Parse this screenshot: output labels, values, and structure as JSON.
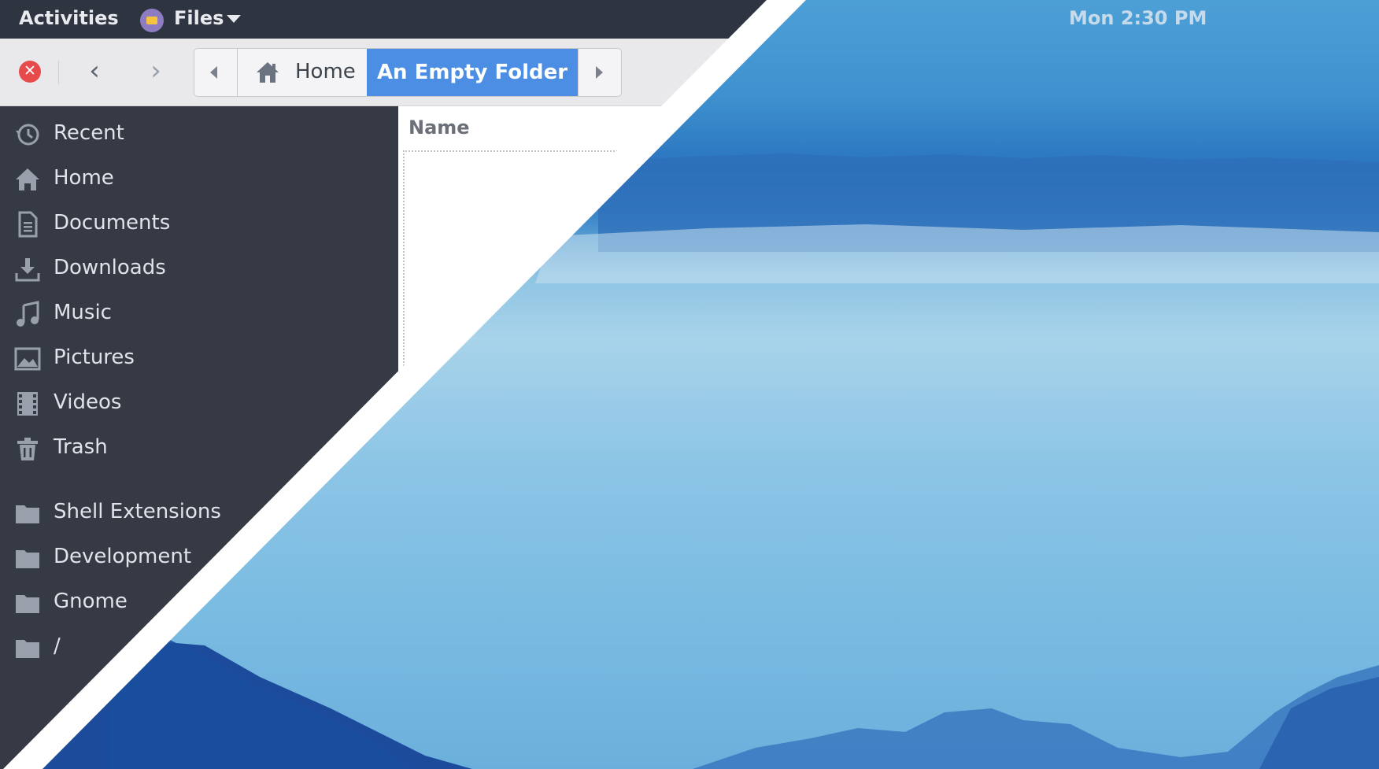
{
  "topbar": {
    "activities": "Activities",
    "app_name": "Files",
    "clock": "Mon  2:30 PM"
  },
  "headerbar": {
    "path": {
      "home_label": "Home",
      "current_label": "An Empty Folder"
    }
  },
  "sidebar": {
    "items": [
      {
        "label": "Recent",
        "icon": "recent-icon"
      },
      {
        "label": "Home",
        "icon": "home-icon"
      },
      {
        "label": "Documents",
        "icon": "document-icon"
      },
      {
        "label": "Downloads",
        "icon": "download-icon"
      },
      {
        "label": "Music",
        "icon": "music-icon"
      },
      {
        "label": "Pictures",
        "icon": "picture-icon"
      },
      {
        "label": "Videos",
        "icon": "video-icon"
      },
      {
        "label": "Trash",
        "icon": "trash-icon"
      }
    ],
    "bookmarks": [
      {
        "label": "Shell Extensions",
        "icon": "folder-icon"
      },
      {
        "label": "Development",
        "icon": "folder-icon"
      },
      {
        "label": "Gnome",
        "icon": "folder-icon"
      },
      {
        "label": "/",
        "icon": "folder-icon"
      }
    ]
  },
  "content": {
    "column_name": "Name"
  },
  "colors": {
    "topbar": "#2e3440",
    "sidebar": "#363a45",
    "accent": "#4b8ee3",
    "close": "#e74a4a"
  }
}
